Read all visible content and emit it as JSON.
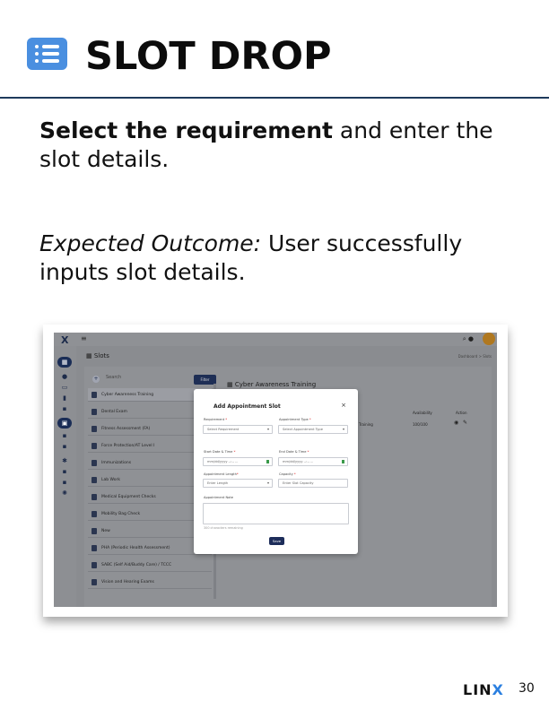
{
  "header": {
    "title": "SLOT DROP",
    "icon": "list-icon",
    "icon_color": "#4a8fe0",
    "rule_color": "#1e3a5c"
  },
  "instruction": {
    "bold": "Select the requirement",
    "rest": " and enter the slot details."
  },
  "outcome": {
    "label": "Expected Outcome:",
    "text": " User successfully inputs slot details."
  },
  "screenshot": {
    "app": {
      "logo": "X",
      "menu_icon": "≡",
      "page_title": "Slots",
      "breadcrumb": "Dashboard > Slots",
      "search_placeholder": "Search",
      "filter_label": "Filter",
      "selected_title": "Cyber Awareness Training",
      "requirements": [
        "Cyber Awareness Training",
        "Dental Exam",
        "Fitness Assessment (FA)",
        "Force Protection/AT Level I",
        "Immunizations",
        "Lab Work",
        "Medical Equipment Checks",
        "Mobility Bag Check",
        "New",
        "PHA (Periodic Health Assessment)",
        "SABC (Self Aid/Buddy Care) / TCCC",
        "Vision and Hearing Exams"
      ],
      "table": {
        "headers": [
          "Availability",
          "Action"
        ],
        "row": {
          "name_fragment": "Training",
          "availability": "100/100"
        }
      }
    },
    "modal": {
      "title": "Add Appointment Slot",
      "close": "×",
      "requirement_label": "Requirement",
      "requirement_placeholder": "Select Requirement",
      "type_label": "Appointment Type",
      "type_placeholder": "Select Appointment Type",
      "start_label": "Start Date & Time",
      "start_placeholder": "mm/dd/yyyy --:-- --",
      "end_label": "End Date & Time",
      "end_placeholder": "mm/dd/yyyy --:-- --",
      "length_label": "Appointment Length",
      "length_placeholder": "Enter Length",
      "capacity_label": "Capacity",
      "capacity_placeholder": "Enter Slot Capacity",
      "note_label": "Appointment Note",
      "hint": "300 characters remaining",
      "save": "Save",
      "required_mark": "*"
    }
  },
  "footer": {
    "logo_a": "LIN",
    "logo_b": "X",
    "page_number": "30"
  }
}
